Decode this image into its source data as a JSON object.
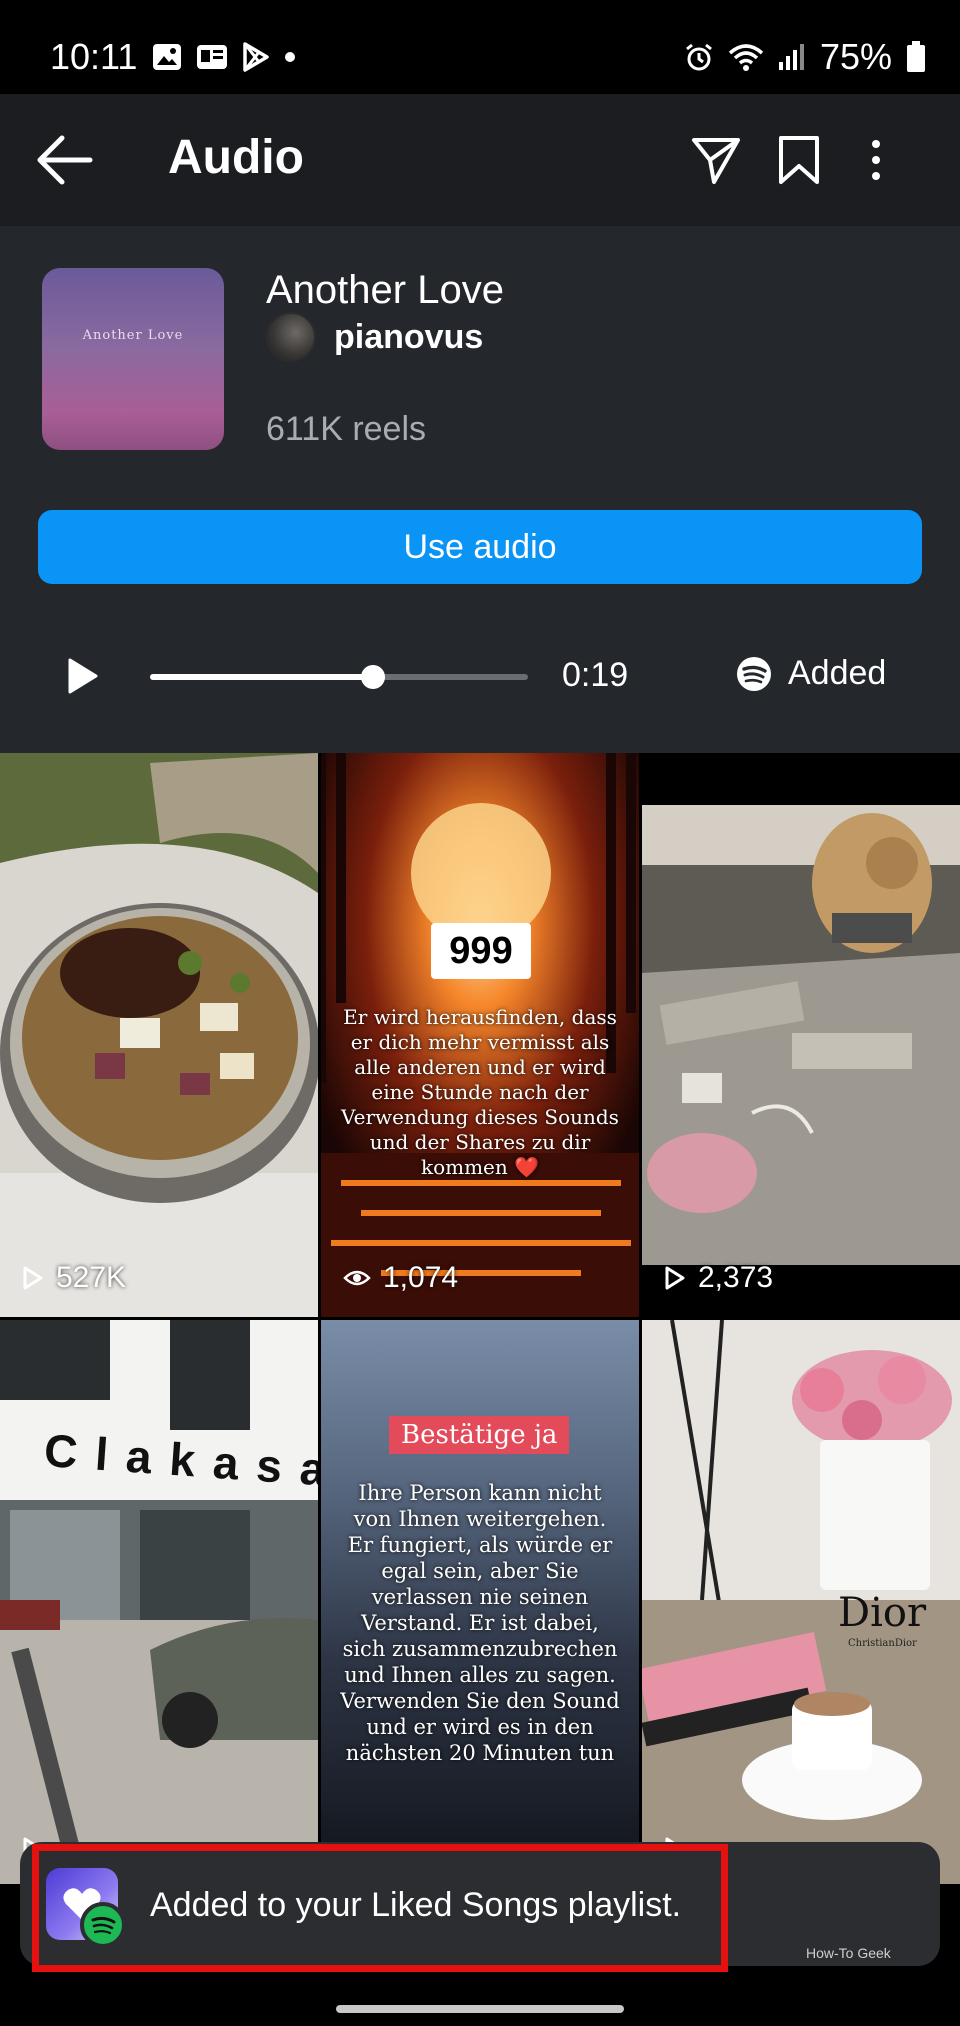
{
  "status_bar": {
    "time": "10:11",
    "battery": "75%"
  },
  "header": {
    "title": "Audio",
    "icons": [
      "back-arrow-icon",
      "send-icon",
      "bookmark-icon",
      "more-vertical-icon"
    ]
  },
  "audio": {
    "album_art_text": "Another Love",
    "song_title": "Another Love",
    "artist": "pianovus",
    "reels_count": "611K reels",
    "use_audio_label": "Use audio",
    "player": {
      "progress_fraction": 0.59,
      "time": "0:19",
      "spotify_label": "Added"
    }
  },
  "reels": [
    {
      "count": "527K",
      "count_icon": "play-icon"
    },
    {
      "count": "1,074",
      "count_icon": "eye-icon",
      "badge": "999",
      "overlay": "Er wird herausfinden, dass er dich mehr vermisst als alle anderen und er wird eine Stunde nach der Verwendung dieses Sounds und der Shares zu dir kommen ❤️"
    },
    {
      "count": "2,373",
      "count_icon": "play-icon"
    },
    {
      "count": "",
      "count_icon": "play-icon",
      "sign": "Clakasa"
    },
    {
      "count": "",
      "count_icon": "eye-icon",
      "badge": "Bestätige ja",
      "overlay": "Ihre Person kann nicht von Ihnen weitergehen. Er fungiert, als würde er egal sein, aber Sie verlassen nie seinen Verstand. Er ist dabei, sich zusammenzubrechen und Ihnen alles zu sagen. Verwenden Sie den Sound und er wird es in den nächsten 20 Minuten tun"
    },
    {
      "count": "",
      "count_icon": "play-icon",
      "brand": "Dior",
      "brand_sub": "ChristianDior"
    }
  ],
  "toast": {
    "message": "Added to your Liked Songs playlist."
  },
  "watermark": "How-To Geek",
  "colors": {
    "accent": "#0a95f6",
    "spotify": "#1db954",
    "highlight_box": "#e51010"
  }
}
